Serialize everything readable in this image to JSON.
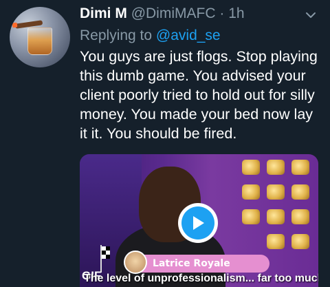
{
  "tweet": {
    "display_name": "Dimi M",
    "handle": "@DimiMAFC",
    "separator": "·",
    "time": "1h",
    "reply_prefix": "Replying to",
    "reply_handle": "@avid_se",
    "text": "You guys are just flogs. Stop playing this dumb game. You advised your client poorly tried to hold out for silly money. You made your bed now lay it it. You should be fired."
  },
  "media": {
    "badge": "GIF",
    "nameplate": "Latrice Royale",
    "caption": "The level of unprofessionalism... far too much."
  },
  "colors": {
    "background": "#15202b",
    "secondary_text": "#8899a6",
    "accent": "#1da1f2"
  },
  "icons": {
    "menu": "chevron-down-icon",
    "play": "play-icon"
  }
}
